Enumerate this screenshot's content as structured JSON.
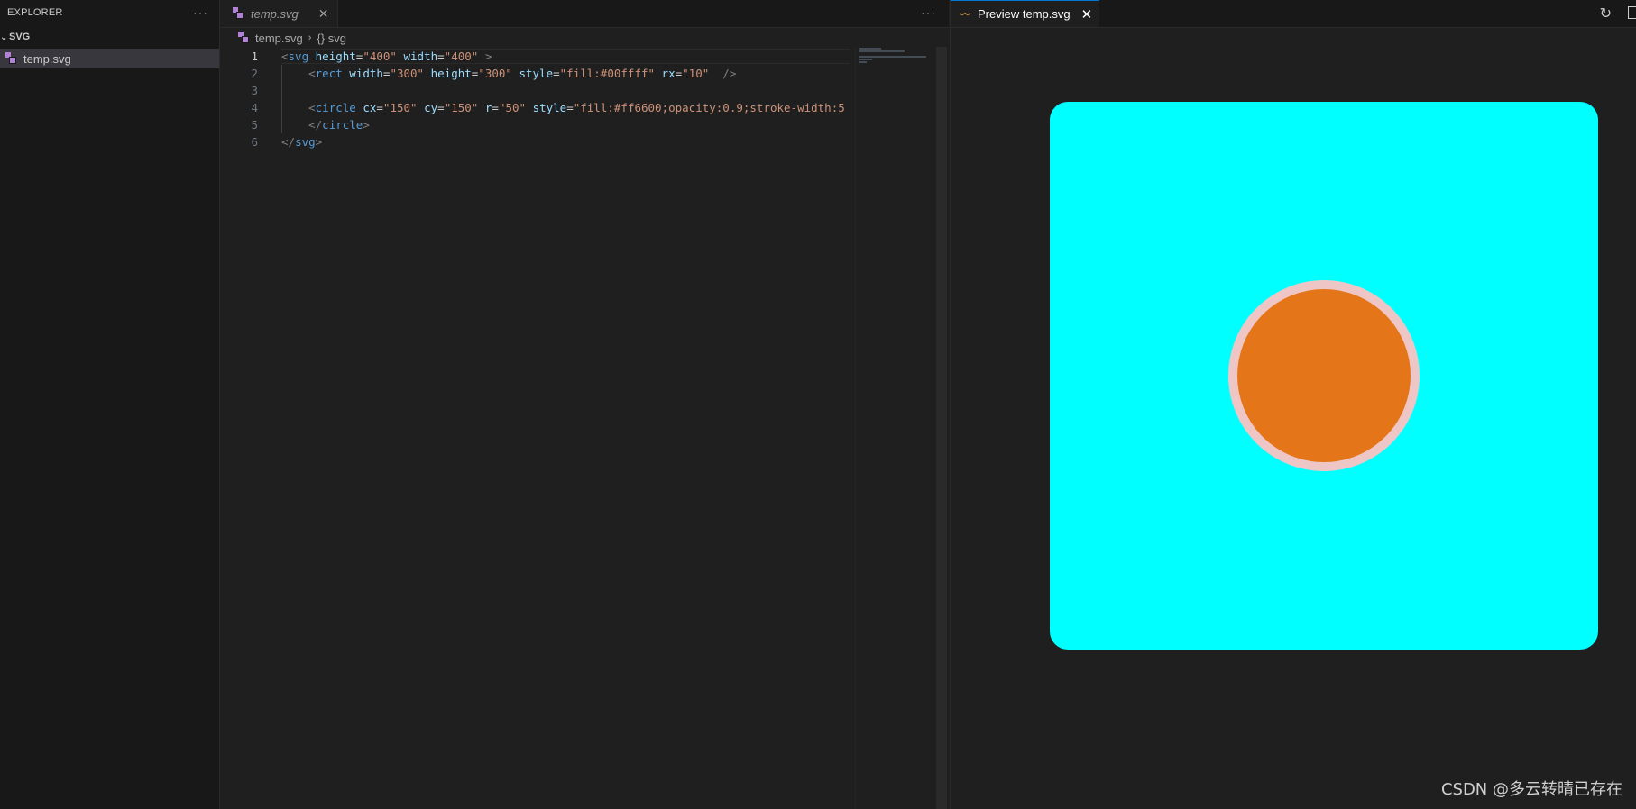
{
  "sidebar": {
    "header": "EXPLORER",
    "more": "···",
    "folder": "SVG",
    "file": "temp.svg",
    "file_icon": "svg-file-icon"
  },
  "editor": {
    "tab": {
      "label": "temp.svg",
      "close": "✕"
    },
    "more": "···",
    "breadcrumb": {
      "file": "temp.svg",
      "symbol": "{} svg"
    },
    "lines": [
      {
        "n": "1"
      },
      {
        "n": "2"
      },
      {
        "n": "3"
      },
      {
        "n": "4"
      },
      {
        "n": "5"
      },
      {
        "n": "6"
      }
    ],
    "code": {
      "l1": {
        "lt": "<",
        "tag": "svg",
        "a1": "height",
        "v1": "\"400\"",
        "a2": "width",
        "v2": "\"400\"",
        "end": " >"
      },
      "l2": {
        "lt": "<",
        "tag": "rect",
        "a1": "width",
        "v1": "\"300\"",
        "a2": "height",
        "v2": "\"300\"",
        "a3": "style",
        "v3": "\"fill:#00ffff\"",
        "a4": "rx",
        "v4": "\"10\"",
        "end": "  />"
      },
      "l4": {
        "lt": "<",
        "tag": "circle",
        "a1": "cx",
        "v1": "\"150\"",
        "a2": "cy",
        "v2": "\"150\"",
        "a3": "r",
        "v3": "\"50\"",
        "a4": "style",
        "v4": "\"fill:#ff6600;opacity:0.9;stroke-width:5"
      },
      "l5": {
        "lt": "</",
        "tag": "circle",
        "gt": ">"
      },
      "l6": {
        "lt": "</",
        "tag": "svg",
        "gt": ">"
      }
    }
  },
  "preview": {
    "tab": {
      "label": "Preview temp.svg",
      "close": "✕",
      "icon": "preview-icon"
    },
    "refresh": "↻",
    "colors": {
      "rect": "#00ffff",
      "circle": "#e47518",
      "stroke": "#efc6c6"
    }
  },
  "watermark": "CSDN @多云转晴已存在"
}
